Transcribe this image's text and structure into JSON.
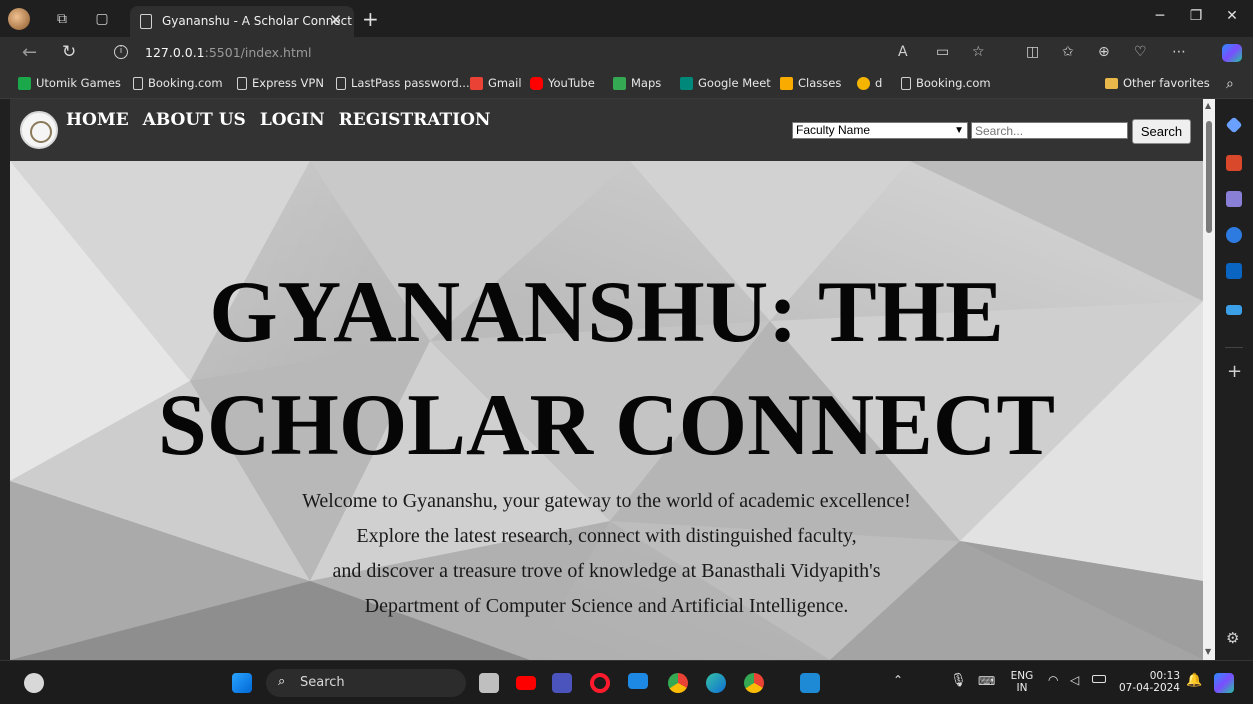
{
  "browser": {
    "tab_title": "Gyananshu - A Scholar Connect",
    "tab_close": "✕",
    "new_tab": "+",
    "url_host": "127.0.0.1",
    "url_rest": ":5501/index.html",
    "window_controls": [
      "─",
      "❐",
      "✕"
    ],
    "bookmarks": [
      {
        "label": "Utomik Games",
        "icon": "utomik-icon",
        "color": "#1aa84a"
      },
      {
        "label": "Booking.com",
        "icon": "page-icon"
      },
      {
        "label": "Express VPN",
        "icon": "page-icon"
      },
      {
        "label": "LastPass password...",
        "icon": "page-icon"
      },
      {
        "label": "Gmail",
        "icon": "gmail-icon",
        "color": "#ea4335"
      },
      {
        "label": "YouTube",
        "icon": "youtube-icon",
        "color": "#ff0000"
      },
      {
        "label": "Maps",
        "icon": "maps-icon",
        "color": "#34a853"
      },
      {
        "label": "Google Meet",
        "icon": "meet-icon",
        "color": "#00897b"
      },
      {
        "label": "Classes",
        "icon": "classroom-icon",
        "color": "#f9ab00"
      },
      {
        "label": "d",
        "icon": "d-icon",
        "color": "#f4b400"
      },
      {
        "label": "Booking.com",
        "icon": "page-icon"
      }
    ],
    "other_favorites": "Other favorites"
  },
  "site": {
    "nav": [
      "HOME",
      "ABOUT US",
      "LOGIN",
      "REGISTRATION"
    ],
    "search_select_value": "Faculty Name",
    "search_placeholder": "Search...",
    "search_button": "Search",
    "hero_title_line1": "GYANANSHU: THE",
    "hero_title_line2": "SCHOLAR CONNECT",
    "hero_lines": [
      "Welcome to Gyananshu, your gateway to the world of academic excellence!",
      "Explore the latest research, connect with distinguished faculty,",
      "and discover a treasure trove of knowledge at Banasthali Vidyapith's",
      "Department of Computer Science and Artificial Intelligence."
    ]
  },
  "taskbar": {
    "search_label": "Search",
    "language_line1": "ENG",
    "language_line2": "IN",
    "time": "00:13",
    "date": "07-04-2024"
  }
}
